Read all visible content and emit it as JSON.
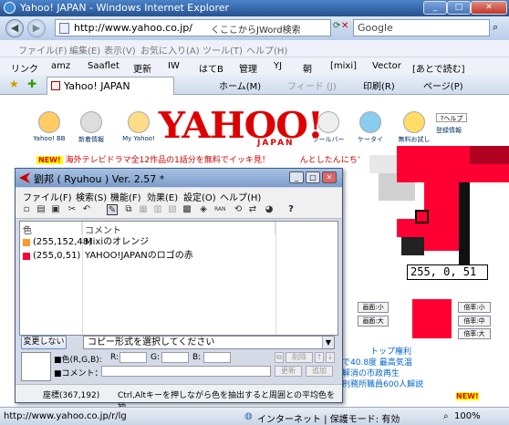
{
  "ie": {
    "title": "Yahoo! JAPAN - Windows Internet Explorer",
    "url": "http://www.yahoo.co.jp/",
    "addr_hint": "くここからJWord検索",
    "search_placeholder": "Google",
    "menu": [
      "ファイル(F)",
      "編集(E)",
      "表示(V)",
      "お気に入り(A)",
      "ツール(T)",
      "ヘルプ(H)"
    ],
    "links_label": "リンク",
    "links": [
      "amz",
      "Saaflet",
      "更新",
      "IW",
      "はてB",
      "管理",
      "YJ",
      "朝",
      "[mixi]",
      "Vector",
      "[あとで読む]"
    ],
    "tab_title": "Yahoo! JAPAN",
    "commands": [
      "ホーム(M)",
      "フィード (J)",
      "印刷(R)",
      "ページ(P)"
    ],
    "status_url": "http://www.yahoo.co.jp/r/lg",
    "status_zone": "インターネット | 保護モード: 有効",
    "zoom": "100%"
  },
  "yahoo": {
    "services": [
      "Yahoo! BB",
      "新着情報",
      "My Yahoo!",
      "ツールバー",
      "ケータイ",
      "無料お試し",
      "登録情報"
    ],
    "help": "?ヘルプ",
    "logo": "YAHOO!",
    "logo_sub": "JAPAN",
    "news_badge": "NEW!",
    "news": "海外テレビドラマ全12作品の1話分を無料でイッキ見！",
    "news2": "んとしたんにちで見て",
    "lines": [
      "トップ権利",
      "で40.8度 最高気温",
      "解消の市政再生",
      "刑務所職員600人解説"
    ],
    "new2": "NEW!"
  },
  "zoom": {
    "pixel_value": "255,  0, 51",
    "buttons": [
      "画面:小",
      "画面:大",
      "倍率:小",
      "倍率:中",
      "倍率:大"
    ]
  },
  "ryuhou": {
    "title": "劉邦 ( Ryuhou ) Ver. 2.57 *",
    "menu": [
      "ファイル(F)",
      "検索(S)",
      "機能(F)",
      "効果(E)",
      "設定(O)",
      "ヘルプ(H)"
    ],
    "col_color": "色",
    "col_comment": "コメント",
    "rows": [
      {
        "rgb": "(255,152,48)",
        "comment": "Mixiのオレンジ",
        "swatch": "#ff9830"
      },
      {
        "rgb": "(255,0,51)",
        "comment": "YAHOO!JAPANのロゴの赤",
        "swatch": "#ff0033"
      }
    ],
    "change_button": "変更しない",
    "copy_format": "コピー形式を選択してください",
    "color_label": "■色(R,G,B):",
    "r_label": "R:",
    "g_label": "G:",
    "b_label": "B:",
    "delete_button": "削除",
    "comment_label": "■コメント：",
    "update_button": "更新",
    "add_button": "追加",
    "coords": "座標(367,192)",
    "hint": "Ctrl,Altキーを押しながら色を抽出すると周囲との平均色を抽"
  }
}
